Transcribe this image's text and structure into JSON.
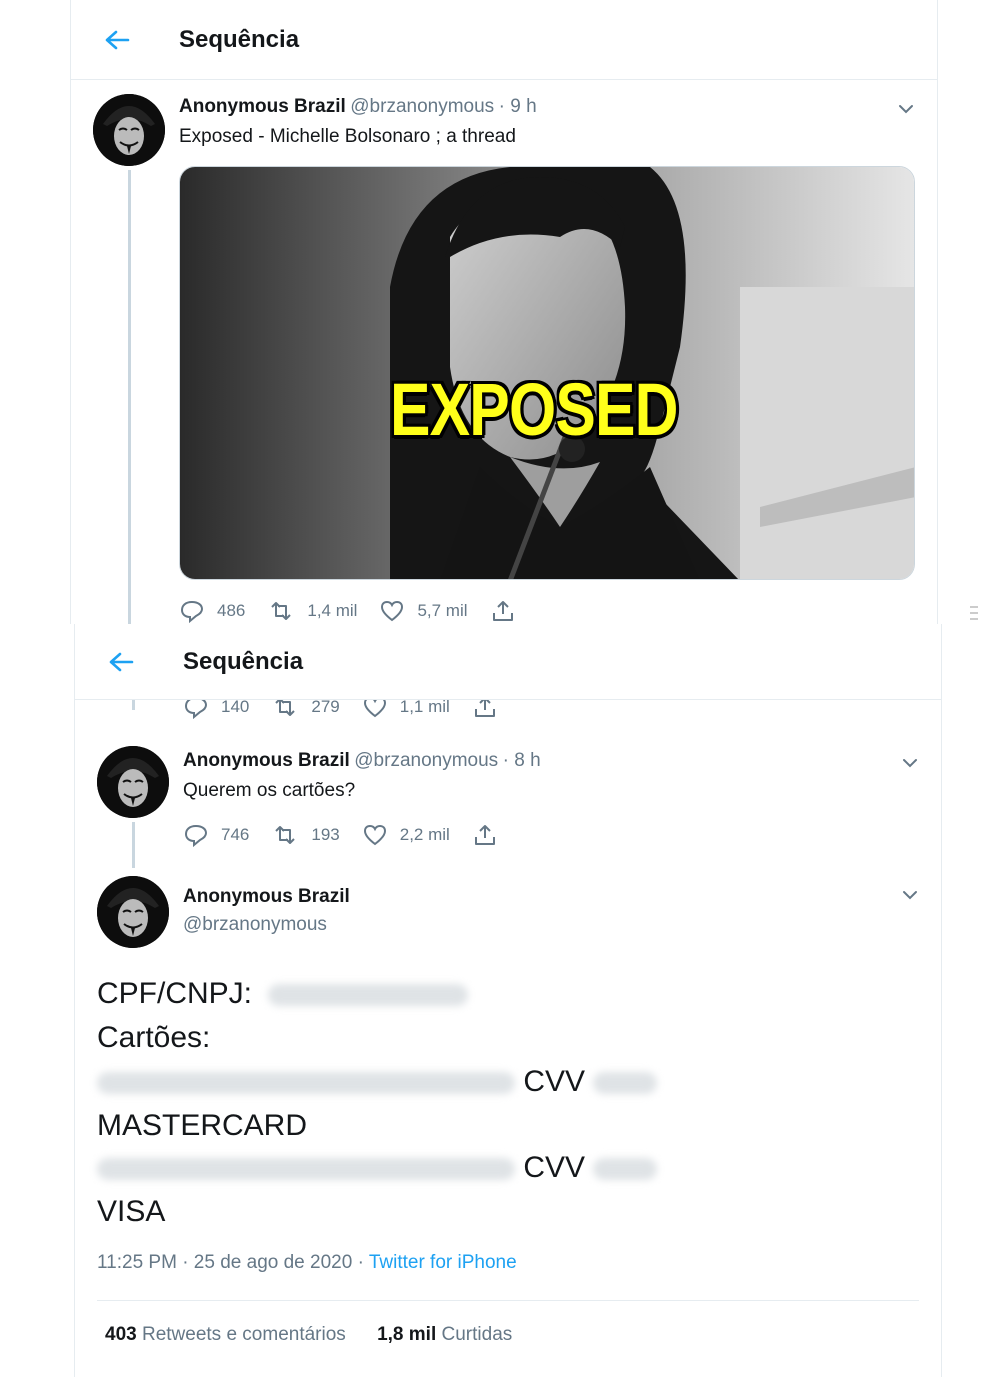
{
  "header": {
    "title": "Sequência"
  },
  "tweet1": {
    "name": "Anonymous Brazil",
    "handle": "@brzanonymous",
    "time": "· 9 h",
    "text": "Exposed - Michelle Bolsonaro ; a thread",
    "media_caption": "EXPOSED",
    "replies": "486",
    "retweets": "1,4 mil",
    "likes": "5,7 mil"
  },
  "header2": {
    "title": "Sequência"
  },
  "partial_actions": {
    "replies": "140",
    "retweets": "279",
    "likes": "1,1 mil"
  },
  "tweet2": {
    "name": "Anonymous Brazil",
    "handle": "@brzanonymous",
    "time": "· 8 h",
    "text": "Querem os cartões?",
    "replies": "746",
    "retweets": "193",
    "likes": "2,2 mil"
  },
  "tweet3": {
    "name": "Anonymous Brazil",
    "handle": "@brzanonymous",
    "line1": "CPF/CNPJ:",
    "line2": "Cartões:",
    "cvv1": "CVV",
    "brand1": "MASTERCARD",
    "cvv2": "CVV",
    "brand2": "VISA",
    "timestamp": "11:25 PM · 25 de ago de 2020 · ",
    "source": "Twitter for iPhone",
    "retweets_count": "403",
    "retweets_label": " Retweets e comentários",
    "likes_count": "1,8 mil",
    "likes_label": " Curtidas"
  },
  "colors": {
    "accent": "#1da1f2",
    "secondary": "#657786",
    "caption": "#ffff1a"
  },
  "icons": [
    "back-arrow-icon",
    "chevron-down-icon",
    "reply-icon",
    "retweet-icon",
    "like-icon",
    "share-icon"
  ]
}
